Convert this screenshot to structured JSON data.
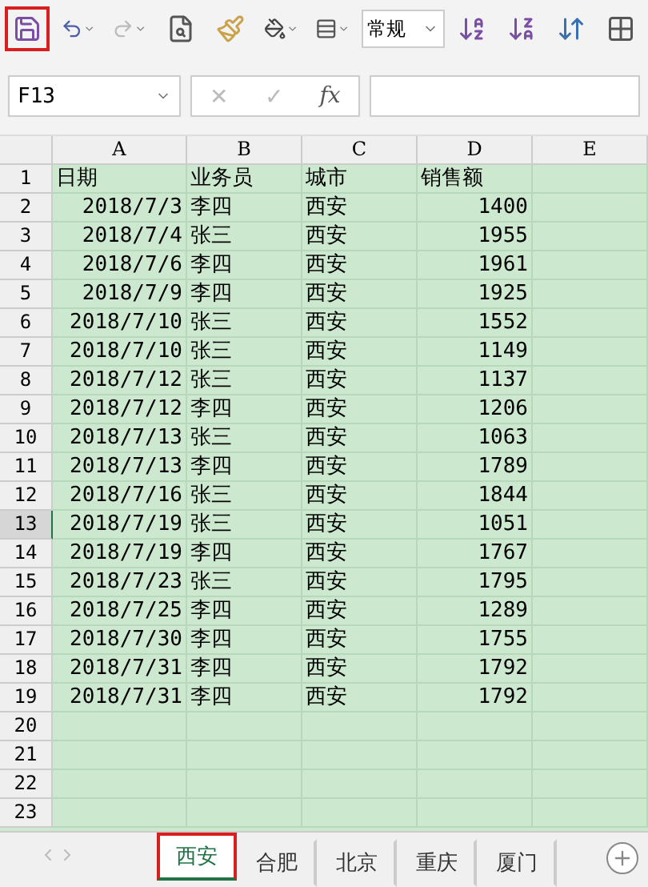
{
  "toolbar": {
    "save": {
      "highlighted": true
    },
    "redo": {
      "disabled": true
    },
    "number_format": "常规"
  },
  "formula_bar": {
    "name_box": "F13",
    "cancel": "✕",
    "confirm": "✓",
    "fx": "fx"
  },
  "columns": [
    {
      "label": "A",
      "selected": false
    },
    {
      "label": "B",
      "selected": false
    },
    {
      "label": "C",
      "selected": false
    },
    {
      "label": "D",
      "selected": false
    },
    {
      "label": "E",
      "selected": false
    }
  ],
  "rows": [
    {
      "number": "1",
      "kind": "header",
      "selected": false,
      "cells": [
        "日期",
        "业务员",
        "城市",
        "销售额"
      ]
    },
    {
      "number": "2",
      "kind": "data",
      "selected": false,
      "cells": [
        "2018/7/3",
        "李四",
        "西安",
        "1400"
      ]
    },
    {
      "number": "3",
      "kind": "data",
      "selected": false,
      "cells": [
        "2018/7/4",
        "张三",
        "西安",
        "1955"
      ]
    },
    {
      "number": "4",
      "kind": "data",
      "selected": false,
      "cells": [
        "2018/7/6",
        "李四",
        "西安",
        "1961"
      ]
    },
    {
      "number": "5",
      "kind": "data",
      "selected": false,
      "cells": [
        "2018/7/9",
        "李四",
        "西安",
        "1925"
      ]
    },
    {
      "number": "6",
      "kind": "data",
      "selected": false,
      "cells": [
        "2018/7/10",
        "张三",
        "西安",
        "1552"
      ]
    },
    {
      "number": "7",
      "kind": "data",
      "selected": false,
      "cells": [
        "2018/7/10",
        "张三",
        "西安",
        "1149"
      ]
    },
    {
      "number": "8",
      "kind": "data",
      "selected": false,
      "cells": [
        "2018/7/12",
        "张三",
        "西安",
        "1137"
      ]
    },
    {
      "number": "9",
      "kind": "data",
      "selected": false,
      "cells": [
        "2018/7/12",
        "李四",
        "西安",
        "1206"
      ]
    },
    {
      "number": "10",
      "kind": "data",
      "selected": false,
      "cells": [
        "2018/7/13",
        "张三",
        "西安",
        "1063"
      ]
    },
    {
      "number": "11",
      "kind": "data",
      "selected": false,
      "cells": [
        "2018/7/13",
        "李四",
        "西安",
        "1789"
      ]
    },
    {
      "number": "12",
      "kind": "data",
      "selected": false,
      "cells": [
        "2018/7/16",
        "张三",
        "西安",
        "1844"
      ]
    },
    {
      "number": "13",
      "kind": "data",
      "selected": true,
      "cells": [
        "2018/7/19",
        "张三",
        "西安",
        "1051"
      ]
    },
    {
      "number": "14",
      "kind": "data",
      "selected": false,
      "cells": [
        "2018/7/19",
        "李四",
        "西安",
        "1767"
      ]
    },
    {
      "number": "15",
      "kind": "data",
      "selected": false,
      "cells": [
        "2018/7/23",
        "张三",
        "西安",
        "1795"
      ]
    },
    {
      "number": "16",
      "kind": "data",
      "selected": false,
      "cells": [
        "2018/7/25",
        "李四",
        "西安",
        "1289"
      ]
    },
    {
      "number": "17",
      "kind": "data",
      "selected": false,
      "cells": [
        "2018/7/30",
        "李四",
        "西安",
        "1755"
      ]
    },
    {
      "number": "18",
      "kind": "data",
      "selected": false,
      "cells": [
        "2018/7/31",
        "李四",
        "西安",
        "1792"
      ]
    },
    {
      "number": "19",
      "kind": "data",
      "selected": false,
      "cells": [
        "2018/7/31",
        "李四",
        "西安",
        "1792"
      ]
    },
    {
      "number": "20",
      "kind": "empty",
      "selected": false
    },
    {
      "number": "21",
      "kind": "empty",
      "selected": false
    },
    {
      "number": "22",
      "kind": "empty",
      "selected": false
    },
    {
      "number": "23",
      "kind": "empty",
      "selected": false
    }
  ],
  "sheet_tabs": [
    {
      "label": "西安",
      "selected": true,
      "highlighted": true
    },
    {
      "label": "合肥",
      "selected": false,
      "highlighted": false
    },
    {
      "label": "北京",
      "selected": false,
      "highlighted": false
    },
    {
      "label": "重庆",
      "selected": false,
      "highlighted": false
    },
    {
      "label": "厦门",
      "selected": false,
      "highlighted": false
    }
  ]
}
